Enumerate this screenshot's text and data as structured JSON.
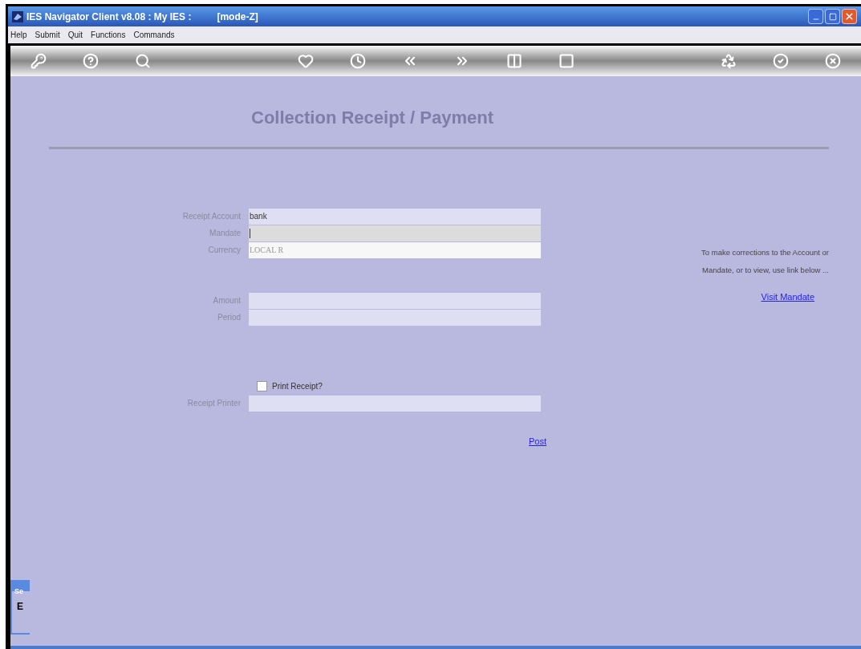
{
  "window": {
    "title": "IES Navigator Client v8.08 : My IES :",
    "mode": "[mode-Z]"
  },
  "menu": [
    "Help",
    "Submit",
    "Quit",
    "Functions",
    "Commands"
  ],
  "page_title": "Collection Receipt / Payment",
  "fields": [
    {
      "label": "Receipt Account",
      "value": "bank",
      "kind": "active"
    },
    {
      "label": "Mandate",
      "kind": "focused"
    },
    {
      "label": "Currency",
      "value": "LOCAL R",
      "kind": "readonly"
    }
  ],
  "amount_fields": [
    {
      "label": "Amount"
    },
    {
      "label": "Period"
    }
  ],
  "print_receipt": {
    "label": "Print Receipt?",
    "checked": false
  },
  "printer_field": {
    "label": "Receipt Printer"
  },
  "post_link": "Post",
  "help_text": [
    "To make corrections to the Account or",
    "Mandate, or to view, use link below ..."
  ],
  "visit_link": "Visit Mandate",
  "bottom_panel": {
    "title": "Se",
    "text": "E"
  }
}
